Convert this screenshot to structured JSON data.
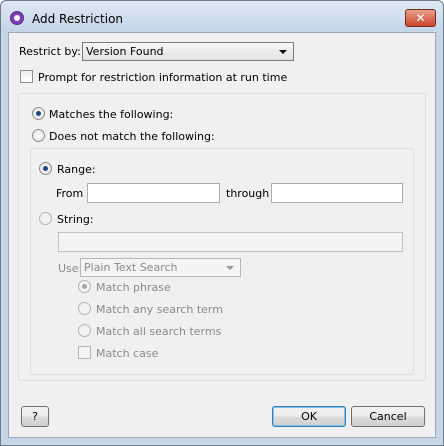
{
  "window": {
    "title": "Add Restriction",
    "close_glyph": "✕"
  },
  "restrict_by": {
    "label": "Restrict by:",
    "value": "Version Found"
  },
  "prompt_checkbox": {
    "label": "Prompt for restriction information at run time",
    "checked": false
  },
  "match_mode": {
    "matches_label": "Matches the following:",
    "not_matches_label": "Does not match the following:",
    "selected": "matches"
  },
  "range": {
    "label": "Range:",
    "from_label": "From",
    "through_label": "through",
    "from_value": "",
    "through_value": "",
    "selected": true
  },
  "string": {
    "label": "String:",
    "value": "",
    "selected": false,
    "use_label": "Use:",
    "use_value": "Plain Text Search",
    "options": {
      "match_phrase": "Match phrase",
      "match_any": "Match any search term",
      "match_all": "Match all search terms",
      "match_case": "Match case"
    }
  },
  "buttons": {
    "help": "?",
    "ok": "OK",
    "cancel": "Cancel"
  }
}
